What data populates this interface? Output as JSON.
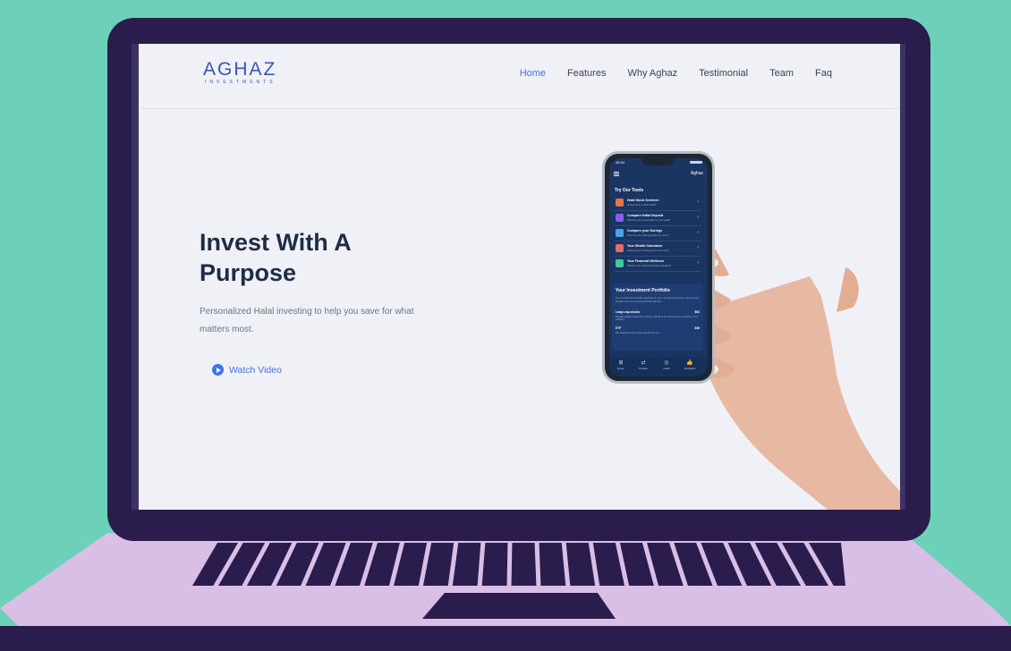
{
  "colors": {
    "background": "#6dd0b8",
    "bezel": "#2a1c4d",
    "base": "#d9bfe6",
    "accent": "#3b74ec",
    "heading": "#1e2d45"
  },
  "logo": {
    "main": "AGHAZ",
    "sub": "INVESTMENTS"
  },
  "nav": [
    {
      "label": "Home",
      "active": true
    },
    {
      "label": "Features",
      "active": false
    },
    {
      "label": "Why Aghaz",
      "active": false
    },
    {
      "label": "Testimonial",
      "active": false
    },
    {
      "label": "Team",
      "active": false
    },
    {
      "label": "Faq",
      "active": false
    }
  ],
  "hero": {
    "title": "Invest With A Purpose",
    "subtitle": "Personalized Halal investing to help you save for what matters most.",
    "watch_label": "Watch Video"
  },
  "phone": {
    "time": "08:34",
    "brand": "Aghaz",
    "tools_title": "Try Our Tools",
    "tools": [
      {
        "title": "Halal Stock Screener",
        "sub": "Is that stock or ETF halal?",
        "color": "#e8744a",
        "icon": "screener-icon"
      },
      {
        "title": "Compare Initial Deposit",
        "sub": "What do you need today for your goal?",
        "color": "#8a5cf0",
        "icon": "deposit-icon"
      },
      {
        "title": "Compare your Savings",
        "sub": "How do your savings grow over time?",
        "color": "#4aa3e8",
        "icon": "savings-icon"
      },
      {
        "title": "Your Wealth Calculator",
        "sub": "How do your savings grow over time?",
        "color": "#e86a6a",
        "icon": "calculator-icon"
      },
      {
        "title": "Your Financial Wellness",
        "sub": "What is your current financial situation?",
        "color": "#3fc99a",
        "icon": "wellness-icon"
      }
    ],
    "portfolio": {
      "title": "Your Investment Portfolio",
      "desc": "Your investment portfolio depends on your risk tolerance level. If you invest $1,000, here's how your portfolio will look.",
      "rows": [
        {
          "label": "Large-cap stocks",
          "value": "$64",
          "sub": "Shariah graded stocks from Identify, optimized for risk/return are included in your portfolio."
        },
        {
          "label": "ETF",
          "value": "$36",
          "sub": "We diversify using a large-cap ETF for you."
        }
      ]
    },
    "tabs": [
      {
        "label": "Home",
        "icon": "home-icon",
        "glyph": "⊞"
      },
      {
        "label": "Transfer",
        "icon": "transfer-icon",
        "glyph": "⇄"
      },
      {
        "label": "Goals",
        "icon": "goals-icon",
        "glyph": "◎"
      },
      {
        "label": "Feedback",
        "icon": "feedback-icon",
        "glyph": "👍"
      }
    ]
  }
}
